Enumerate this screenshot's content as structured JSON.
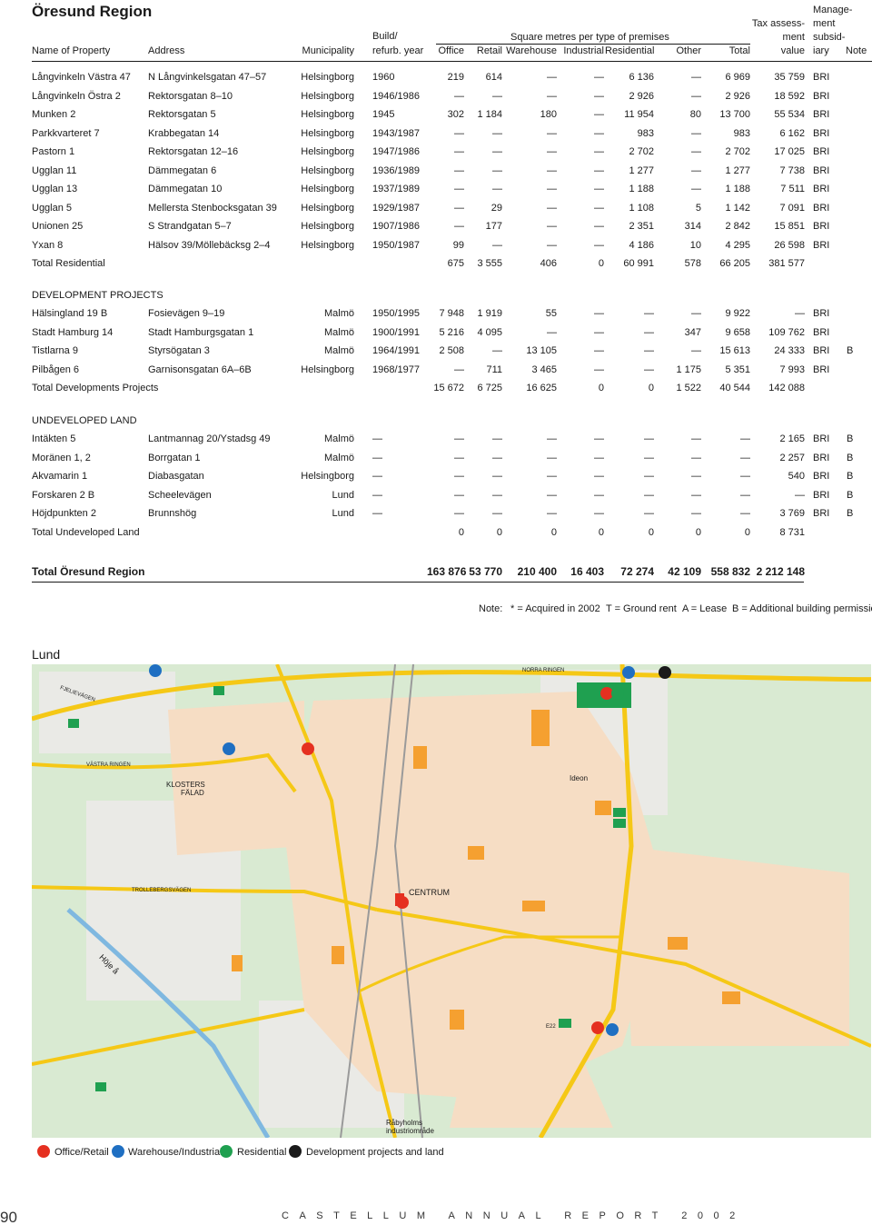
{
  "region_title": "Öresund Region",
  "headers": {
    "name": "Name of Property",
    "address": "Address",
    "municipality": "Municipality",
    "build_1": "Build/",
    "build_2": "refurb. year",
    "sqm_group": "Square metres per type of premises",
    "office": "Office",
    "retail": "Retail",
    "warehouse": "Warehouse",
    "industrial": "Industrial",
    "residential": "Residential",
    "other": "Other",
    "total": "Total",
    "tax_1": "Tax assess-",
    "tax_2": "ment",
    "tax_3": "value",
    "mgmt_1": "Manage-",
    "mgmt_2": "ment",
    "mgmt_3": "subsid-",
    "mgmt_4": "iary",
    "note": "Note"
  },
  "residential_rows": [
    [
      "Långvinkeln Västra 47",
      "N Långvinkelsgatan 47–57",
      "Helsingborg",
      "1960",
      "219",
      "614",
      "—",
      "—",
      "6 136",
      "—",
      "6 969",
      "35 759",
      "BRI",
      ""
    ],
    [
      "Långvinkeln Östra 2",
      "Rektorsgatan 8–10",
      "Helsingborg",
      "1946/1986",
      "—",
      "—",
      "—",
      "—",
      "2 926",
      "—",
      "2 926",
      "18 592",
      "BRI",
      ""
    ],
    [
      "Munken 2",
      "Rektorsgatan 5",
      "Helsingborg",
      "1945",
      "302",
      "1 184",
      "180",
      "—",
      "11 954",
      "80",
      "13 700",
      "55 534",
      "BRI",
      ""
    ],
    [
      "Parkkvarteret 7",
      "Krabbegatan 14",
      "Helsingborg",
      "1943/1987",
      "—",
      "—",
      "—",
      "—",
      "983",
      "—",
      "983",
      "6 162",
      "BRI",
      ""
    ],
    [
      "Pastorn 1",
      "Rektorsgatan 12–16",
      "Helsingborg",
      "1947/1986",
      "—",
      "—",
      "—",
      "—",
      "2 702",
      "—",
      "2 702",
      "17 025",
      "BRI",
      ""
    ],
    [
      "Ugglan 11",
      "Dämmegatan 6",
      "Helsingborg",
      "1936/1989",
      "—",
      "—",
      "—",
      "—",
      "1 277",
      "—",
      "1 277",
      "7 738",
      "BRI",
      ""
    ],
    [
      "Ugglan 13",
      "Dämmegatan 10",
      "Helsingborg",
      "1937/1989",
      "—",
      "—",
      "—",
      "—",
      "1 188",
      "—",
      "1 188",
      "7 511",
      "BRI",
      ""
    ],
    [
      "Ugglan 5",
      "Mellersta Stenbocksgatan 39",
      "Helsingborg",
      "1929/1987",
      "—",
      "29",
      "—",
      "—",
      "1 108",
      "5",
      "1 142",
      "7 091",
      "BRI",
      ""
    ],
    [
      "Unionen 25",
      "S Strandgatan 5–7",
      "Helsingborg",
      "1907/1986",
      "—",
      "177",
      "—",
      "—",
      "2 351",
      "314",
      "2 842",
      "15 851",
      "BRI",
      ""
    ],
    [
      "Yxan 8",
      "Hälsov 39/Möllebäcksg 2–4",
      "Helsingborg",
      "1950/1987",
      "99",
      "—",
      "—",
      "—",
      "4 186",
      "10",
      "4 295",
      "26 598",
      "BRI",
      ""
    ]
  ],
  "residential_total": [
    "Total Residential",
    "",
    "",
    "",
    "675",
    "3 555",
    "406",
    "0",
    "60 991",
    "578",
    "66 205",
    "381 577",
    "",
    ""
  ],
  "dev_label": "DEVELOPMENT PROJECTS",
  "dev_rows": [
    [
      "Hälsingland 19 B",
      "Fosievägen 9–19",
      "Malmö",
      "1950/1995",
      "7 948",
      "1 919",
      "55",
      "—",
      "—",
      "—",
      "9 922",
      "—",
      "BRI",
      ""
    ],
    [
      "Stadt Hamburg 14",
      "Stadt Hamburgsgatan 1",
      "Malmö",
      "1900/1991",
      "5 216",
      "4 095",
      "—",
      "—",
      "—",
      "347",
      "9 658",
      "109 762",
      "BRI",
      ""
    ],
    [
      "Tistlarna 9",
      "Styrsögatan 3",
      "Malmö",
      "1964/1991",
      "2 508",
      "—",
      "13 105",
      "—",
      "—",
      "—",
      "15 613",
      "24 333",
      "BRI",
      "B"
    ],
    [
      "Pilbågen 6",
      "Garnisonsgatan 6A–6B",
      "Helsingborg",
      "1968/1977",
      "—",
      "711",
      "3 465",
      "—",
      "—",
      "1 175",
      "5 351",
      "7 993",
      "BRI",
      ""
    ]
  ],
  "dev_total": [
    "Total Developments Projects",
    "",
    "",
    "",
    "15 672",
    "6 725",
    "16 625",
    "0",
    "0",
    "1 522",
    "40 544",
    "142 088",
    "",
    ""
  ],
  "undev_label": "UNDEVELOPED LAND",
  "undev_rows": [
    [
      "Intäkten 5",
      "Lantmannag 20/Ystadsg 49",
      "Malmö",
      "—",
      "—",
      "—",
      "—",
      "—",
      "—",
      "—",
      "—",
      "2 165",
      "BRI",
      "B"
    ],
    [
      "Moränen 1, 2",
      "Borrgatan 1",
      "Malmö",
      "—",
      "—",
      "—",
      "—",
      "—",
      "—",
      "—",
      "—",
      "2 257",
      "BRI",
      "B"
    ],
    [
      "Akvamarin 1",
      "Diabasgatan",
      "Helsingborg",
      "—",
      "—",
      "—",
      "—",
      "—",
      "—",
      "—",
      "—",
      "540",
      "BRI",
      "B"
    ],
    [
      "Forskaren 2 B",
      "Scheelevägen",
      "Lund",
      "—",
      "—",
      "—",
      "—",
      "—",
      "—",
      "—",
      "—",
      "—",
      "BRI",
      "B"
    ],
    [
      "Höjdpunkten 2",
      "Brunnshög",
      "Lund",
      "—",
      "—",
      "—",
      "—",
      "—",
      "—",
      "—",
      "—",
      "3 769",
      "BRI",
      "B"
    ]
  ],
  "undev_total": [
    "Total Undeveloped Land",
    "",
    "",
    "",
    "0",
    "0",
    "0",
    "0",
    "0",
    "0",
    "0",
    "8 731",
    "",
    ""
  ],
  "grand_total": [
    "Total Öresund Region",
    "",
    "",
    "",
    "163 876",
    "53 770",
    "210 400",
    "16 403",
    "72 274",
    "42 109",
    "558 832",
    "2 212 148",
    "",
    ""
  ],
  "note_line": {
    "label": "Note:",
    "acquired": "* = Acquired in 2002",
    "ground": "T = Ground rent",
    "lease": "A = Lease",
    "permission": "B = Additional building permission"
  },
  "map": {
    "title": "Lund",
    "labels": {
      "klosters_1": "KLOSTERS",
      "klosters_2": "FÄLAD",
      "ideon": "Ideon",
      "centrum": "CENTRUM",
      "hoje": "Höje å",
      "rabyholms_1": "Råbyholms",
      "rabyholms_2": "industriområde",
      "norra_ringen": "NORRA RINGEN",
      "vastra_ringen": "VÄSTRA RINGEN",
      "trolleberg": "TROLLEBERGSVÄGEN",
      "dalby": "DALBYVÄGEN",
      "fjelievagen": "FJELIEVÄGEN",
      "e22": "E22"
    },
    "colors": {
      "office_retail": "#e53020",
      "warehouse_industrial": "#1f6fc2",
      "residential": "#1fa050",
      "development": "#1a1a1a"
    }
  },
  "legend": {
    "office_retail": "Office/Retail",
    "warehouse_industrial": "Warehouse/Industrial",
    "residential": "Residential",
    "development": "Development projects and land"
  },
  "footer": {
    "page_number": "90",
    "report_title": "CASTELLUM ANNUAL REPORT 2002"
  }
}
